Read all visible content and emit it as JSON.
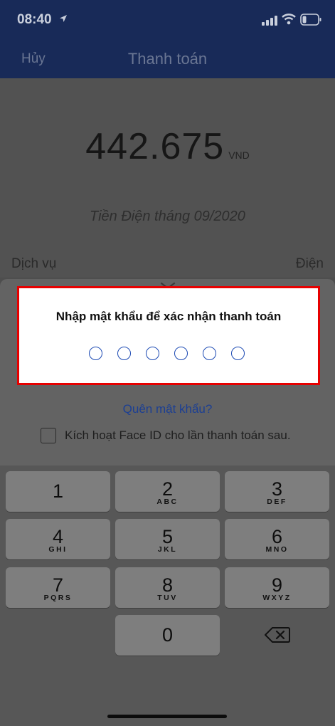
{
  "status_bar": {
    "time": "08:40"
  },
  "nav": {
    "cancel": "Hủy",
    "title": "Thanh toán"
  },
  "payment": {
    "amount": "442.675",
    "currency": "VND",
    "description": "Tiền Điện tháng 09/2020",
    "service_label": "Dịch vụ",
    "service_value": "Điện"
  },
  "pin_dialog": {
    "title": "Nhập mật khẩu để xác nhận thanh toán",
    "digit_count": 6,
    "forgot_link": "Quên mật khẩu?",
    "faceid_label": "Kích hoạt Face ID cho lần thanh toán sau.",
    "faceid_checked": false
  },
  "keypad": {
    "keys": [
      {
        "num": "1",
        "letters": ""
      },
      {
        "num": "2",
        "letters": "ABC"
      },
      {
        "num": "3",
        "letters": "DEF"
      },
      {
        "num": "4",
        "letters": "GHI"
      },
      {
        "num": "5",
        "letters": "JKL"
      },
      {
        "num": "6",
        "letters": "MNO"
      },
      {
        "num": "7",
        "letters": "PQRS"
      },
      {
        "num": "8",
        "letters": "TUV"
      },
      {
        "num": "9",
        "letters": "WXYZ"
      },
      {
        "num": "0",
        "letters": ""
      }
    ]
  },
  "colors": {
    "accent": "#1b49b3",
    "highlight_border": "#e60000",
    "nav_bg": "#182a58"
  }
}
